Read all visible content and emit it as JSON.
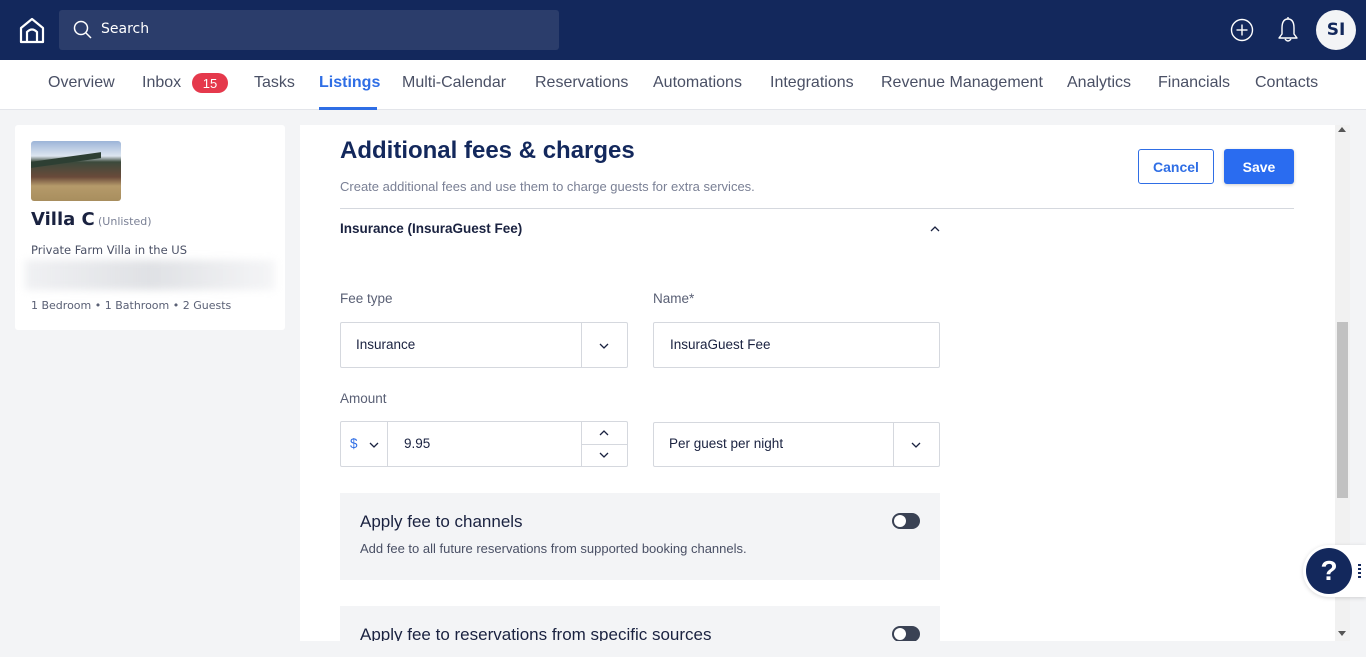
{
  "topbar": {
    "search_placeholder": "Search",
    "avatar_initials": "SI",
    "icons": [
      "home-icon",
      "search-icon",
      "plus-circle-icon",
      "bell-icon"
    ]
  },
  "nav": {
    "items": [
      {
        "label": "Overview"
      },
      {
        "label": "Inbox",
        "badge": "15"
      },
      {
        "label": "Tasks"
      },
      {
        "label": "Listings",
        "active": true
      },
      {
        "label": "Multi-Calendar"
      },
      {
        "label": "Reservations"
      },
      {
        "label": "Automations"
      },
      {
        "label": "Integrations"
      },
      {
        "label": "Revenue Management"
      },
      {
        "label": "Analytics"
      },
      {
        "label": "Financials"
      },
      {
        "label": "Contacts"
      }
    ],
    "accent": "#2f6ee5",
    "badge_color": "#e5394c"
  },
  "listing": {
    "name": "Villa C",
    "status": "(Unlisted)",
    "description": "Private Farm Villa in the US",
    "meta": "1 Bedroom  •  1 Bathroom  •  2 Guests"
  },
  "main": {
    "title": "Additional fees & charges",
    "subtitle": "Create additional fees and use them to charge guests for extra services.",
    "cancel_label": "Cancel",
    "save_label": "Save",
    "section_title": "Insurance (InsuraGuest Fee)",
    "form": {
      "fee_type_label": "Fee type",
      "fee_type_value": "Insurance",
      "name_label": "Name*",
      "name_value": "InsuraGuest Fee",
      "amount_label": "Amount",
      "currency_symbol": "$",
      "amount_value": "9.95",
      "frequency_value": "Per guest per night"
    },
    "panels": [
      {
        "title": "Apply fee to channels",
        "description": "Add fee to all future reservations from supported booking channels.",
        "enabled": false
      },
      {
        "title": "Apply fee to reservations from specific sources",
        "enabled": false
      }
    ]
  },
  "help": {
    "label": "?"
  }
}
